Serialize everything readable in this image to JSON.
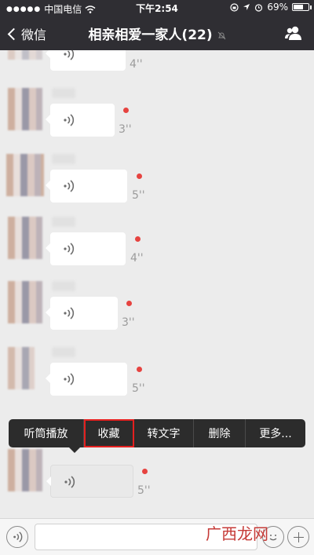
{
  "status_bar": {
    "signal": "●●●●●",
    "carrier": "中国电信",
    "time": "下午2:54",
    "battery": "69%",
    "battery_level": 0.69
  },
  "nav": {
    "back_label": "微信",
    "title": "相亲相爱一家人(22)"
  },
  "messages": [
    {
      "duration": "4''",
      "unread": false
    },
    {
      "duration": "3''",
      "unread": true
    },
    {
      "duration": "5''",
      "unread": true
    },
    {
      "duration": "4''",
      "unread": true
    },
    {
      "duration": "3''",
      "unread": true
    },
    {
      "duration": "5''",
      "unread": true
    },
    {
      "duration": "5''",
      "unread": true
    }
  ],
  "context_menu": {
    "items": [
      "听筒播放",
      "收藏",
      "转文字",
      "删除",
      "更多..."
    ],
    "highlighted": "收藏"
  },
  "watermark": "广西龙网",
  "colors": {
    "header_bg": "#2f2e33",
    "unread_dot": "#e64340",
    "highlight_border": "#e5201f"
  }
}
